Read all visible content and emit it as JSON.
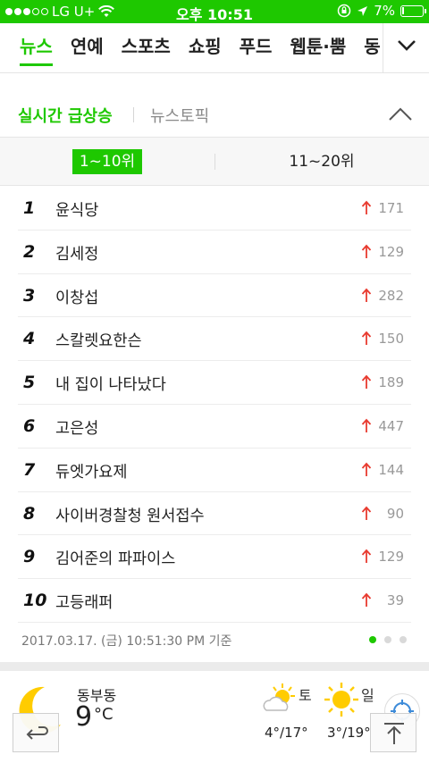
{
  "status_bar": {
    "carrier": "LG U+",
    "time": "오후 10:51",
    "battery_text": "7%",
    "battery_level": 0.07,
    "signal_filled": 3,
    "signal_total": 5
  },
  "nav": {
    "tabs": [
      "뉴스",
      "연예",
      "스포츠",
      "쇼핑",
      "푸드",
      "웹툰·뿜",
      "동영상"
    ],
    "active_tab": "뉴스"
  },
  "trending": {
    "tab_realtime": "실시간 급상승",
    "tab_news_topic": "뉴스토픽",
    "range_tabs": [
      "1~10위",
      "11~20위"
    ],
    "items": [
      {
        "rank": "1",
        "term": "윤식당",
        "count": "171"
      },
      {
        "rank": "2",
        "term": "김세정",
        "count": "129"
      },
      {
        "rank": "3",
        "term": "이창섭",
        "count": "282"
      },
      {
        "rank": "4",
        "term": "스칼렛요한슨",
        "count": "150"
      },
      {
        "rank": "5",
        "term": "내 집이 나타났다",
        "count": "189"
      },
      {
        "rank": "6",
        "term": "고은성",
        "count": "447"
      },
      {
        "rank": "7",
        "term": "듀엣가요제",
        "count": "144"
      },
      {
        "rank": "8",
        "term": "사이버경찰청 원서접수",
        "count": "90"
      },
      {
        "rank": "9",
        "term": "김어준의 파파이스",
        "count": "129"
      },
      {
        "rank": "10",
        "term": "고등래퍼",
        "count": "39"
      }
    ],
    "timestamp": "2017.03.17. (금) 10:51:30 PM 기준",
    "page_count": 3,
    "current_page": 1
  },
  "weather": {
    "location": "동부동",
    "temperature": "9",
    "unit": "°C",
    "forecast": [
      {
        "day": "토",
        "range": "4°/17°",
        "icon": "partly-sunny-icon"
      },
      {
        "day": "일",
        "range": "3°/19°",
        "icon": "sunny-icon"
      }
    ]
  },
  "colors": {
    "brand_green": "#1ec800",
    "rise_arrow": "#e83a2f"
  }
}
